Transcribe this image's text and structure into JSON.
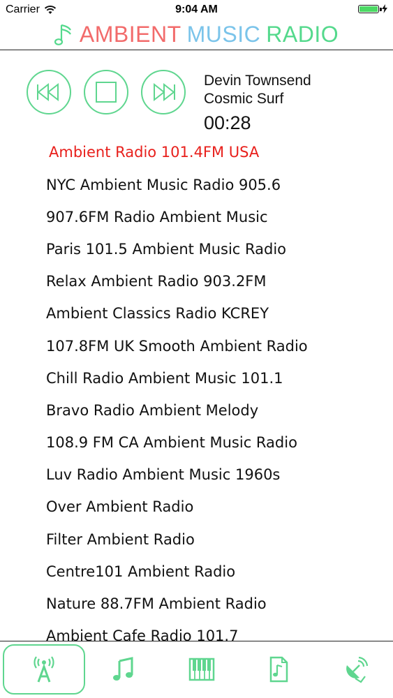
{
  "status_bar": {
    "carrier": "Carrier",
    "time": "9:04 AM",
    "battery_level": 1.0
  },
  "header": {
    "title_word_1": "AMBIENT",
    "title_word_2": "MUSIC",
    "title_word_3": "RADIO",
    "icon": "music-note-icon",
    "colors": {
      "ambient": "#f26b6b",
      "music": "#7bc4ea",
      "radio": "#54d98c"
    }
  },
  "player": {
    "artist": "Devin Townsend",
    "track": "Cosmic Surf",
    "elapsed": "00:28",
    "controls": [
      "rewind-icon",
      "stop-icon",
      "fast-forward-icon"
    ],
    "accent": "#5fd68f"
  },
  "stations": [
    {
      "name": "Ambient Radio 101.4FM USA",
      "active": true
    },
    {
      "name": "NYC Ambient Music Radio 905.6"
    },
    {
      "name": "907.6FM Radio Ambient Music"
    },
    {
      "name": "Paris 101.5 Ambient Music Radio"
    },
    {
      "name": "Relax Ambient Radio 903.2FM"
    },
    {
      "name": "Ambient Classics Radio KCREY"
    },
    {
      "name": "107.8FM UK Smooth Ambient Radio"
    },
    {
      "name": "Chill Radio Ambient Music 101.1"
    },
    {
      "name": "Bravo Radio Ambient Melody"
    },
    {
      "name": "108.9 FM CA Ambient Music Radio"
    },
    {
      "name": "Luv Radio Ambient Music 1960s"
    },
    {
      "name": "Over Ambient Radio"
    },
    {
      "name": "Filter Ambient Radio"
    },
    {
      "name": "Centre101 Ambient Radio"
    },
    {
      "name": "Nature 88.7FM Ambient Radio"
    },
    {
      "name": "Ambient Cafe Radio 101.7"
    }
  ],
  "active_color": "#e8201c",
  "tabs": [
    {
      "icon": "radio-antenna-icon",
      "selected": true
    },
    {
      "icon": "music-note-icon"
    },
    {
      "icon": "piano-keys-icon"
    },
    {
      "icon": "music-file-icon"
    },
    {
      "icon": "satellite-dish-icon"
    }
  ]
}
